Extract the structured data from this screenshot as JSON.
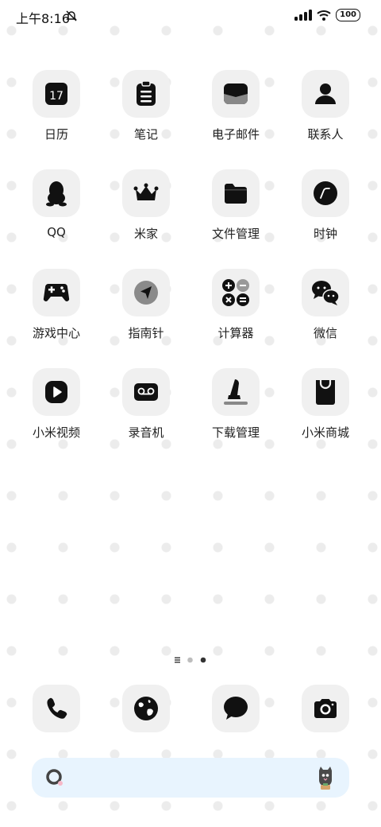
{
  "status_bar": {
    "time": "上午8:16",
    "battery": "100"
  },
  "apps": [
    {
      "label": "日历",
      "icon": "calendar-icon",
      "badge_text": "17"
    },
    {
      "label": "笔记",
      "icon": "notes-icon"
    },
    {
      "label": "电子邮件",
      "icon": "email-icon"
    },
    {
      "label": "联系人",
      "icon": "contacts-icon"
    },
    {
      "label": "QQ",
      "icon": "qq-penguin-icon"
    },
    {
      "label": "米家",
      "icon": "crown-icon"
    },
    {
      "label": "文件管理",
      "icon": "folder-icon"
    },
    {
      "label": "时钟",
      "icon": "clock-icon"
    },
    {
      "label": "游戏中心",
      "icon": "gamepad-icon"
    },
    {
      "label": "指南针",
      "icon": "compass-icon"
    },
    {
      "label": "计算器",
      "icon": "calculator-icon"
    },
    {
      "label": "微信",
      "icon": "wechat-icon"
    },
    {
      "label": "小米视频",
      "icon": "video-play-icon"
    },
    {
      "label": "录音机",
      "icon": "recorder-icon"
    },
    {
      "label": "下载管理",
      "icon": "download-icon"
    },
    {
      "label": "小米商城",
      "icon": "shopping-bag-icon"
    }
  ],
  "page_indicator": {
    "pages": 3,
    "current": 3
  },
  "dock": [
    {
      "icon": "phone-icon"
    },
    {
      "icon": "browser-globe-icon"
    },
    {
      "icon": "message-bubble-icon"
    },
    {
      "icon": "camera-icon"
    }
  ],
  "colors": {
    "tile_bg": "#f0f0f0",
    "icon_fg": "#111111",
    "search_bg": "#e8f4fe",
    "dot_pattern": "#ececec"
  }
}
